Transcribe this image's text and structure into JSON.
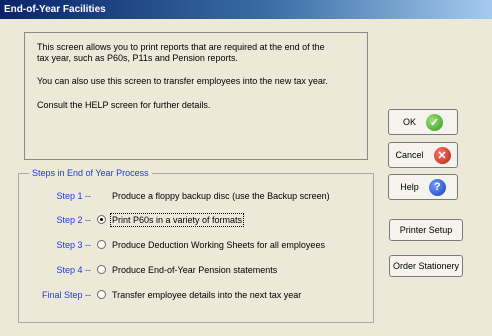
{
  "window": {
    "title": "End-of-Year Facilities"
  },
  "info": {
    "line1": "This screen allows you to print reports that are required at the end of the",
    "line2": "tax year, such as P60s, P11s and Pension reports.",
    "line3": "You can also use this screen to transfer employees into the new tax year.",
    "line4": "Consult the HELP screen for further details."
  },
  "steps_group": {
    "legend": "Steps in End of Year Process",
    "steps": [
      {
        "label": "Step 1 --",
        "text": "Produce a floppy backup disc (use the Backup screen)",
        "has_radio": false,
        "selected": false
      },
      {
        "label": "Step 2 --",
        "text": "Print P60s in a variety of formats",
        "has_radio": true,
        "selected": true
      },
      {
        "label": "Step 3 --",
        "text": "Produce Deduction Working Sheets for all employees",
        "has_radio": true,
        "selected": false
      },
      {
        "label": "Step 4 --",
        "text": "Produce End-of-Year Pension statements",
        "has_radio": true,
        "selected": false
      },
      {
        "label": "Final Step --",
        "text": "Transfer employee details into the next tax year",
        "has_radio": true,
        "selected": false
      }
    ]
  },
  "buttons": {
    "ok": "OK",
    "cancel": "Cancel",
    "help": "Help",
    "printer_setup": "Printer Setup",
    "order_stationery": "Order Stationery"
  },
  "icons": {
    "ok": "check-icon",
    "cancel": "close-icon",
    "help": "question-icon"
  },
  "colors": {
    "title_bar": "#0a246a",
    "step_label": "#1f3bd6",
    "background": "#ece9d8"
  }
}
